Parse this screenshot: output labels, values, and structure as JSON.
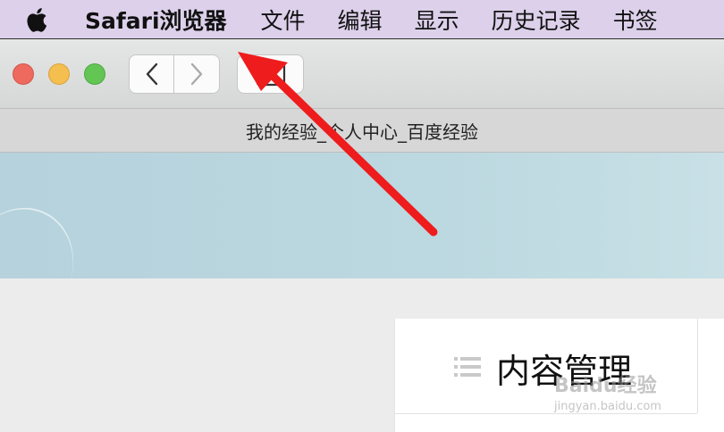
{
  "menubar": {
    "app_name": "Safari浏览器",
    "items": [
      "文件",
      "编辑",
      "显示",
      "历史记录",
      "书签"
    ]
  },
  "toolbar": {
    "back_icon": "chevron-left-icon",
    "forward_icon": "chevron-right-icon",
    "sidebar_icon": "sidebar-icon"
  },
  "tab": {
    "title": "我的经验_个人中心_百度经验"
  },
  "card": {
    "title": "内容管理",
    "icon": "list-icon"
  },
  "watermark": {
    "main": "Baidu经验",
    "sub": "jingyan.baidu.com"
  },
  "colors": {
    "menubar": "#dcd0ea",
    "arrow": "#ee1c1c",
    "banner": "#b8d4de"
  }
}
